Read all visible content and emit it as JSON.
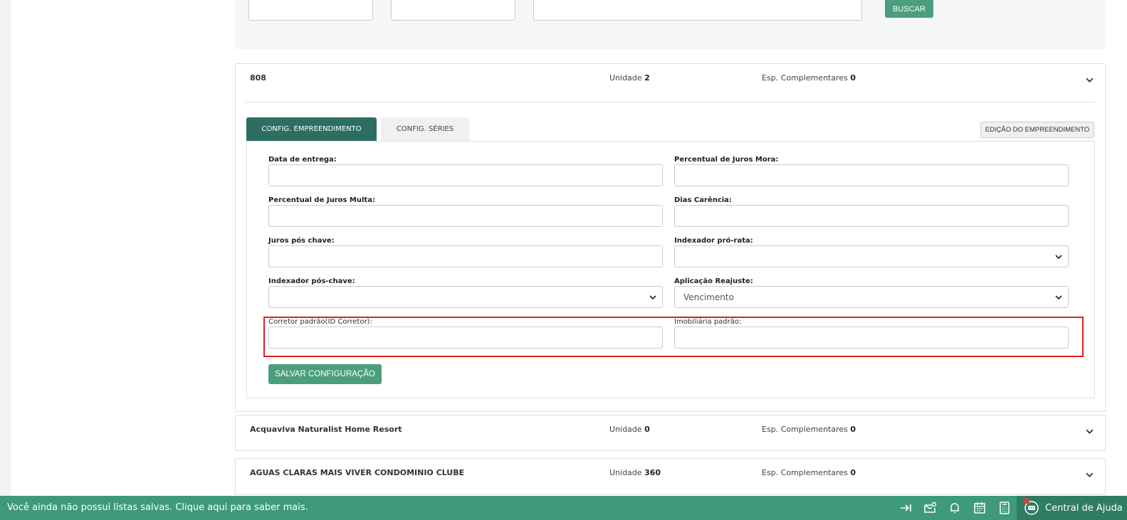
{
  "filters": {
    "buscar_label": "BUSCAR"
  },
  "cards": [
    {
      "name": "808",
      "unit_label": "Unidade",
      "unit_value": "2",
      "esp_label": "Esp. Complementares",
      "esp_value": "0"
    },
    {
      "name": "Acquaviva Naturalist Home Resort",
      "unit_label": "Unidade",
      "unit_value": "0",
      "esp_label": "Esp. Complementares",
      "esp_value": "0"
    },
    {
      "name": "AGUAS CLARAS MAIS VIVER CONDOMINIO CLUBE",
      "unit_label": "Unidade",
      "unit_value": "360",
      "esp_label": "Esp. Complementares",
      "esp_value": "0"
    }
  ],
  "tabs": {
    "active": "CONFIG. EMPREENDIMENTO",
    "other": "CONFIG. SÉRIES",
    "edit_button": "EDIÇÃO DO EMPREENDIMENTO"
  },
  "form": {
    "data_entrega": {
      "label": "Data de entrega:",
      "value": ""
    },
    "juros_mora": {
      "label": "Percentual de Juros Mora:",
      "value": ""
    },
    "juros_multa": {
      "label": "Percentual de Juros Multa:",
      "value": ""
    },
    "dias_carencia": {
      "label": "Dias Carência:",
      "value": ""
    },
    "juros_pos_chave": {
      "label": "Juros pós chave:",
      "value": ""
    },
    "indexador_pro_rata": {
      "label": "Indexador pró-rata:",
      "value": ""
    },
    "indexador_pos_chave": {
      "label": "Indexador pós-chave:",
      "value": ""
    },
    "aplicacao_reajuste": {
      "label": "Aplicação Reajuste:",
      "value": "Vencimento"
    },
    "corretor_padrao": {
      "label": "Corretor padrão(ID Corretor):",
      "value": ""
    },
    "imobiliaria_padrao": {
      "label": "Imobiliária padrão:",
      "value": ""
    },
    "save_label": "SALVAR CONFIGURAÇÃO"
  },
  "bottom_bar": {
    "message": "Você ainda não possui listas salvas. Clique aqui para saber mais.",
    "help_label": "Central de Ajuda"
  },
  "colors": {
    "primary_green": "#4a9e7e",
    "dark_green": "#2e6e62",
    "highlight_red": "#e02020"
  }
}
